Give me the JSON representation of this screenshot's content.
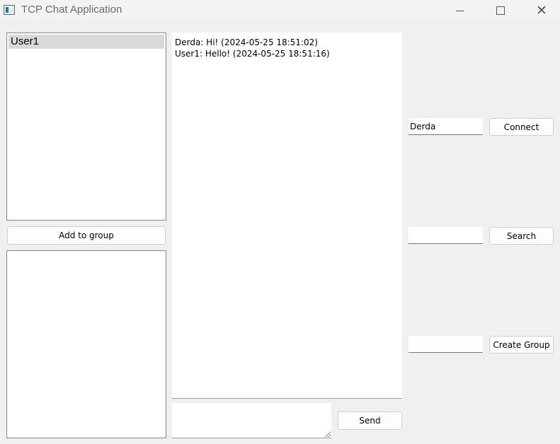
{
  "window": {
    "title": "TCP Chat Application",
    "controls": [
      "minimize-icon",
      "maximize-icon",
      "close-icon"
    ]
  },
  "users": {
    "items": [
      "User1"
    ],
    "selected": "User1"
  },
  "groups": {
    "items": []
  },
  "add_to_group_label": "Add to group",
  "chat": {
    "messages": [
      "Derda: Hi! (2024-05-25 18:51:02)",
      "User1: Hello! (2024-05-25 18:51:16)"
    ]
  },
  "message_input": {
    "value": ""
  },
  "send_label": "Send",
  "connect": {
    "username_value": "Derda",
    "button_label": "Connect"
  },
  "search": {
    "value": "",
    "button_label": "Search"
  },
  "create_group": {
    "value": "",
    "button_label": "Create Group"
  },
  "colors": {
    "background": "#f0f0f0",
    "selected_item": "#d9d9d9",
    "panel": "#ffffff"
  }
}
